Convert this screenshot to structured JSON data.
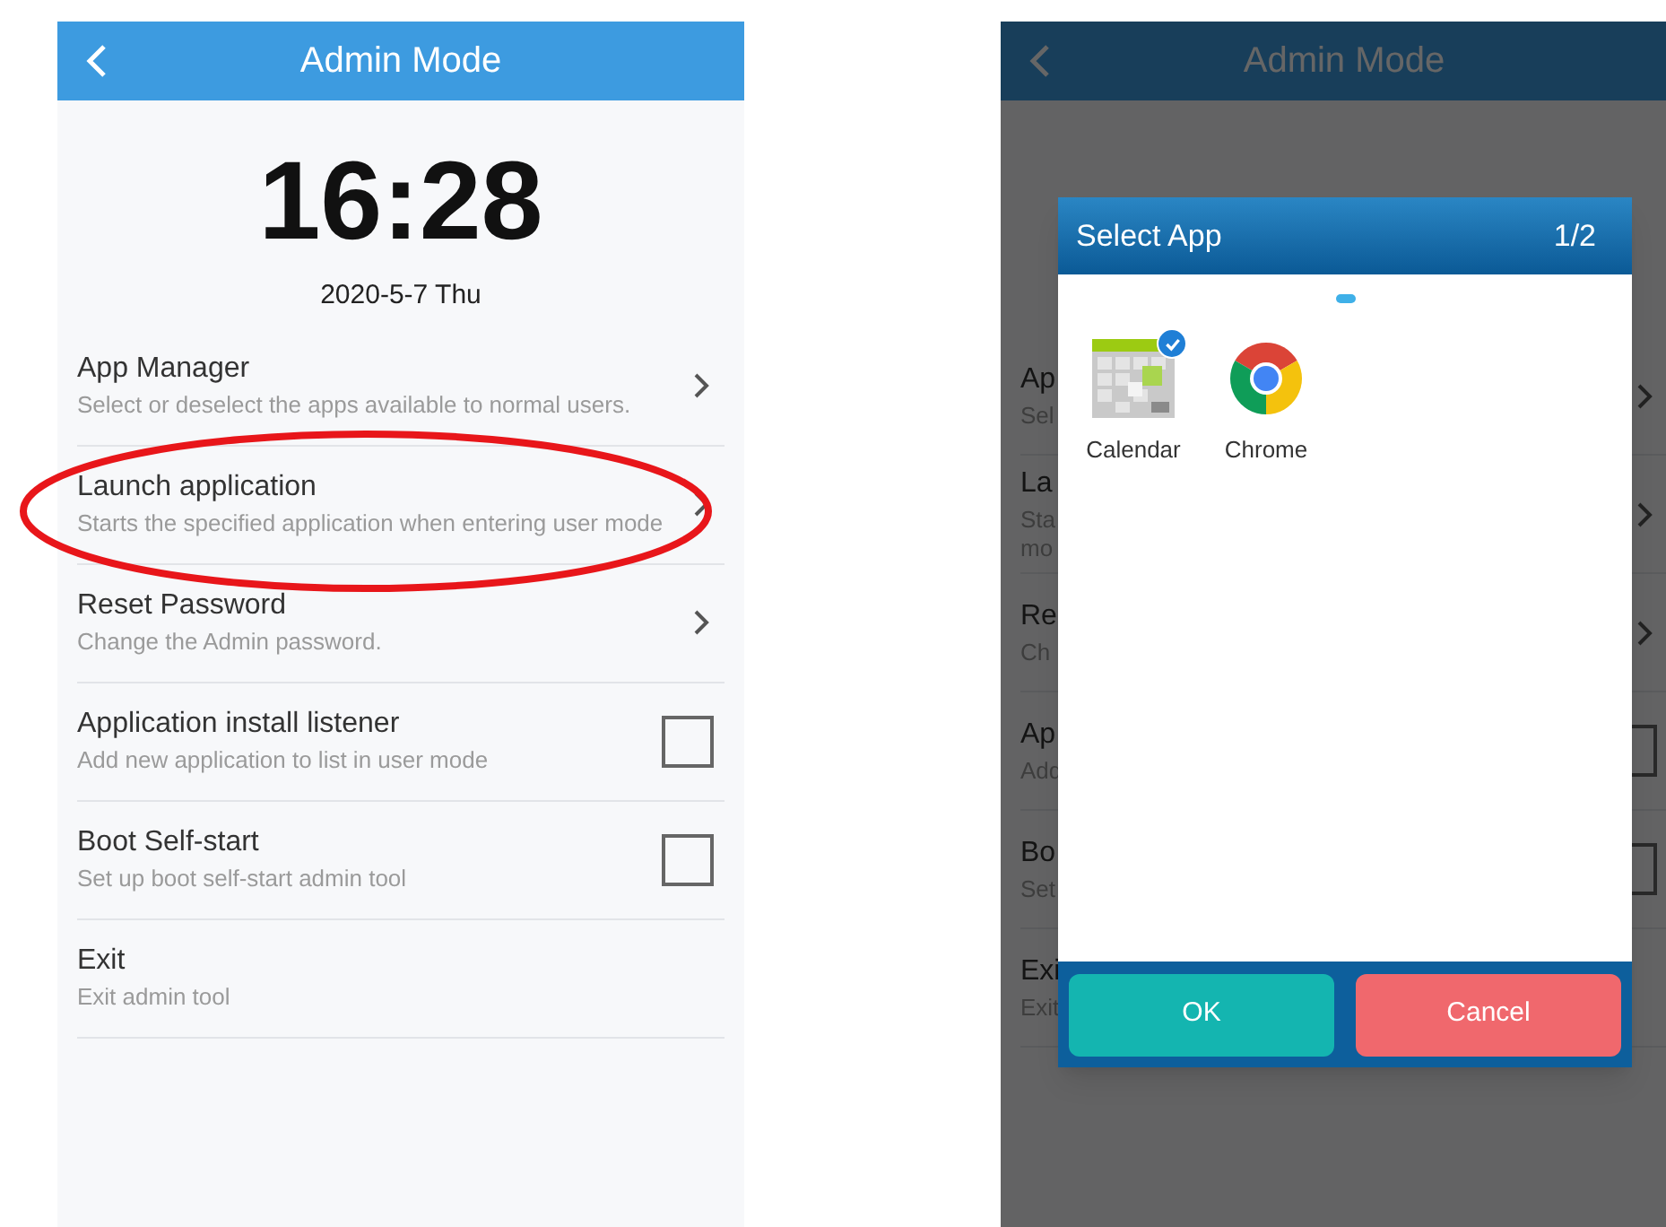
{
  "left_screen": {
    "title": "Admin Mode",
    "clock": "16:28",
    "date": "2020-5-7 Thu",
    "items": [
      {
        "title": "App Manager",
        "subtitle": "Select or deselect the apps available to normal users.",
        "kind": "link",
        "highlighted": false
      },
      {
        "title": "Launch application",
        "subtitle": "Starts the specified application when entering user mode",
        "kind": "link",
        "highlighted": true
      },
      {
        "title": "Reset Password",
        "subtitle": "Change the Admin password.",
        "kind": "link",
        "highlighted": false
      },
      {
        "title": "Application install listener",
        "subtitle": "Add new application to list in user mode",
        "kind": "checkbox",
        "checked": false,
        "highlighted": false
      },
      {
        "title": "Boot Self-start",
        "subtitle": "Set up boot self-start admin tool",
        "kind": "checkbox",
        "checked": false,
        "highlighted": false
      },
      {
        "title": "Exit",
        "subtitle": "Exit admin tool",
        "kind": "plain",
        "highlighted": false
      }
    ]
  },
  "right_screen": {
    "title": "Admin Mode",
    "items": [
      {
        "title": "Ap",
        "subtitle_lines": [
          "Sel"
        ],
        "kind": "link"
      },
      {
        "title": "La",
        "subtitle_lines": [
          "Sta",
          "mo"
        ],
        "kind": "link"
      },
      {
        "title": "Re",
        "subtitle_lines": [
          "Ch"
        ],
        "kind": "link"
      },
      {
        "title": "Ap",
        "subtitle_lines": [
          "Add"
        ],
        "kind": "checkbox"
      },
      {
        "title": "Bo",
        "subtitle_lines": [
          "Set"
        ],
        "kind": "checkbox"
      },
      {
        "title": "Exi",
        "subtitle_lines": [
          "Exit"
        ],
        "kind": "plain"
      }
    ],
    "dialog": {
      "title": "Select App",
      "page": "1/2",
      "apps": [
        {
          "label": "Calendar",
          "kind": "calendar",
          "selected": true
        },
        {
          "label": "Chrome",
          "kind": "chrome",
          "selected": false
        }
      ],
      "buttons": [
        {
          "label": "OK",
          "kind": "confirm"
        },
        {
          "label": "Cancel",
          "kind": "cancel"
        }
      ]
    }
  }
}
